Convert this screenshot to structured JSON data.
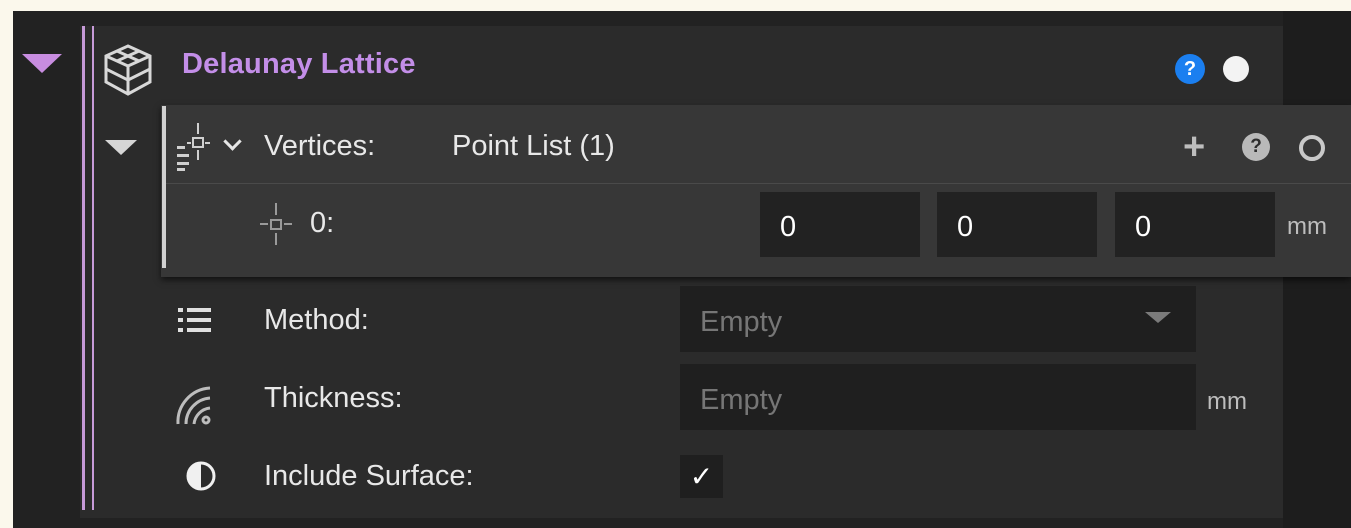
{
  "node": {
    "title": "Delaunay Lattice",
    "help_symbol": "?",
    "icon": "lattice-cube-icon",
    "accent_color": "#c38ee8"
  },
  "vertices": {
    "label": "Vertices:",
    "value": "Point List (1)",
    "add_symbol": "+",
    "help_symbol": "?",
    "points": [
      {
        "index_label": "0:",
        "x": "0",
        "y": "0",
        "z": "0",
        "unit": "mm"
      }
    ]
  },
  "properties": {
    "method": {
      "label": "Method:",
      "placeholder": "Empty",
      "icon": "list-icon"
    },
    "thickness": {
      "label": "Thickness:",
      "placeholder": "Empty",
      "unit": "mm",
      "icon": "thickness-icon"
    },
    "include_surface": {
      "label": "Include Surface:",
      "checked": true,
      "check_symbol": "✓",
      "icon": "contrast-icon"
    }
  },
  "colors": {
    "help_blue": "#1b7ff0",
    "panel_bg": "#2b2b2b",
    "field_bg": "#1f1f1f"
  }
}
